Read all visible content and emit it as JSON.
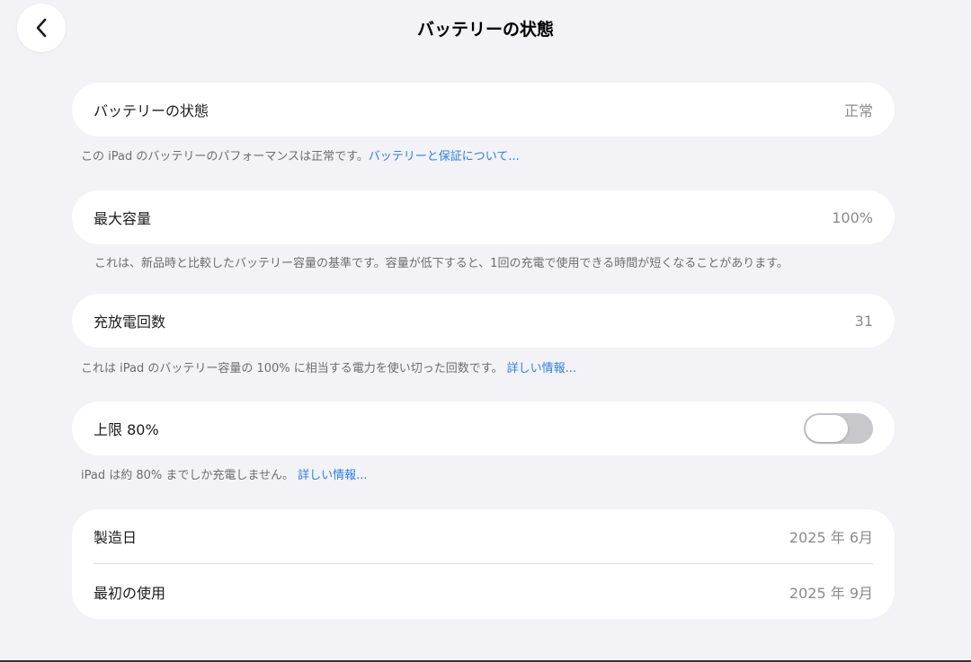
{
  "nav": {
    "title": "バッテリーの状態"
  },
  "battery_health": {
    "label": "バッテリーの状態",
    "value": "正常",
    "footer_text": "この iPad のバッテリーのパフォーマンスは正常です。",
    "footer_link": "バッテリーと保証について..."
  },
  "max_capacity": {
    "label": "最大容量",
    "value": "100%",
    "footer_text": "これは、新品時と比較したバッテリー容量の基準です。容量が低下すると、1回の充電で使用できる時間が短くなることがあります。"
  },
  "cycle_count": {
    "label": "充放電回数",
    "value": "31",
    "footer_text": "これは iPad のバッテリー容量の 100% に相当する電力を使い切った回数です。",
    "footer_link": "詳しい情報..."
  },
  "limit": {
    "label": "上限 80%",
    "toggle_on": false,
    "footer_text": "iPad は約 80% までしか充電しません。",
    "footer_link": "詳しい情報..."
  },
  "dates": {
    "manufacture_label": "製造日",
    "manufacture_value": "2025 年 6月",
    "first_use_label": "最初の使用",
    "first_use_value": "2025 年 9月"
  },
  "colors": {
    "background": "#f2f2f7",
    "card": "#ffffff",
    "link": "#2f7fe0",
    "toggle_off": "#c7c7cc"
  },
  "icons": {
    "back": "chevron-left-icon"
  }
}
